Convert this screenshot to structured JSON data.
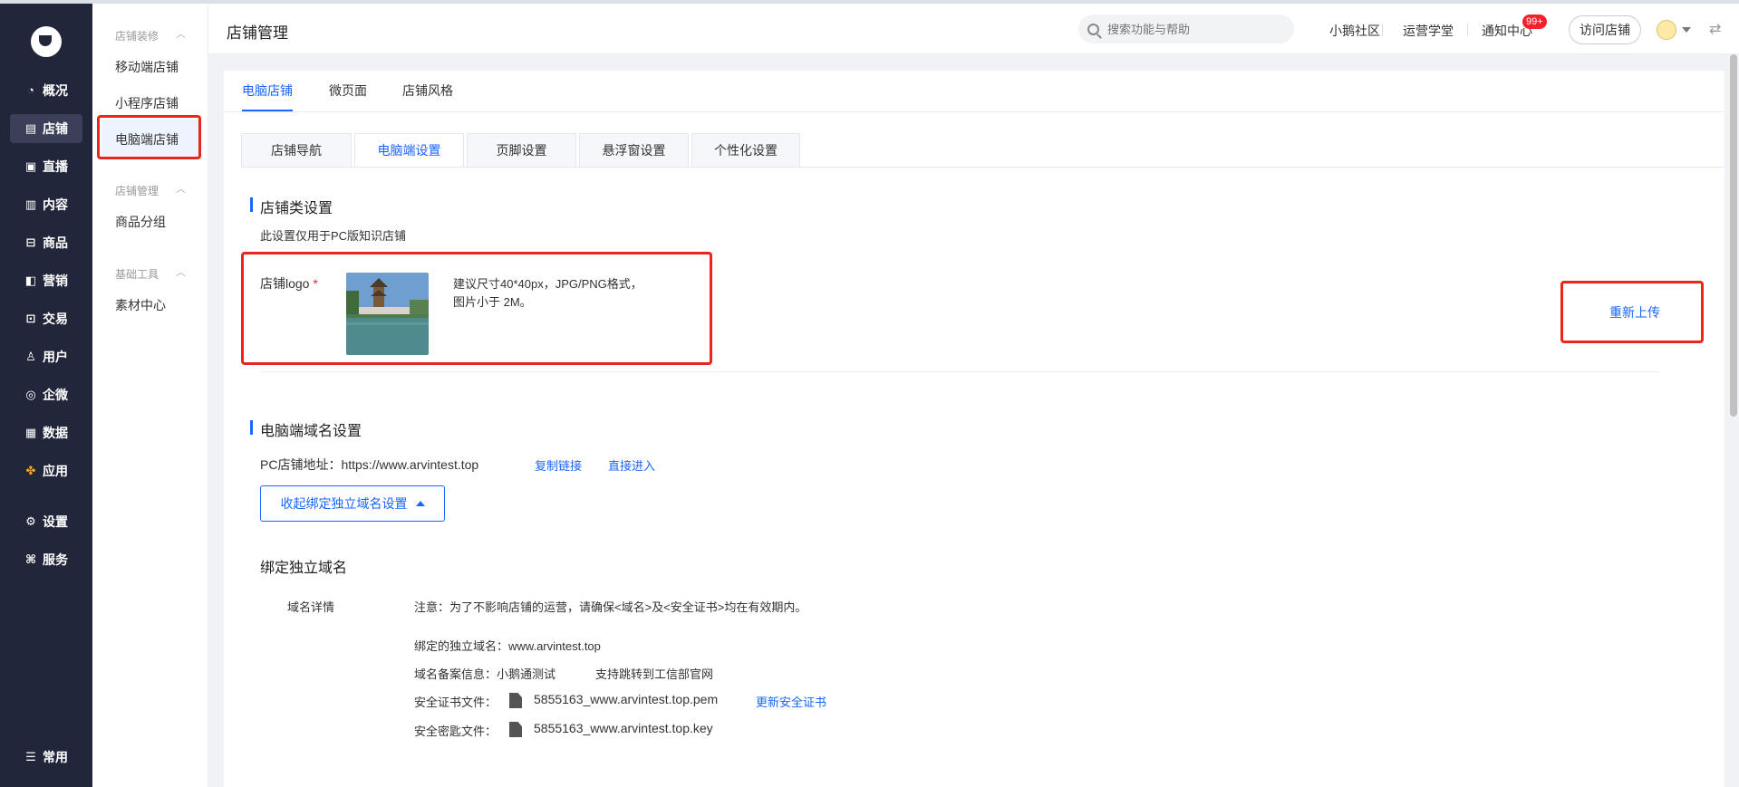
{
  "left_nav": {
    "items": [
      {
        "label": "概况",
        "icon": "pie-chart-icon"
      },
      {
        "label": "店铺",
        "icon": "store-icon"
      },
      {
        "label": "直播",
        "icon": "live-icon"
      },
      {
        "label": "内容",
        "icon": "document-icon"
      },
      {
        "label": "商品",
        "icon": "goods-icon"
      },
      {
        "label": "营销",
        "icon": "megaphone-icon"
      },
      {
        "label": "交易",
        "icon": "trade-icon"
      },
      {
        "label": "用户",
        "icon": "user-icon"
      },
      {
        "label": "企微",
        "icon": "wecom-icon"
      },
      {
        "label": "数据",
        "icon": "data-icon"
      },
      {
        "label": "应用",
        "icon": "apps-icon"
      },
      {
        "label": "设置",
        "icon": "gear-icon"
      },
      {
        "label": "服务",
        "icon": "service-icon"
      }
    ],
    "bottom": {
      "label": "常用",
      "icon": "list-icon"
    },
    "active_index": 1
  },
  "sub_nav": {
    "group1": {
      "title": "店铺装修",
      "items": [
        "移动端店铺",
        "小程序店铺",
        "电脑端店铺"
      ]
    },
    "group2": {
      "title": "店铺管理",
      "items": [
        "商品分组"
      ]
    },
    "group3": {
      "title": "基础工具",
      "items": [
        "素材中心"
      ]
    }
  },
  "header": {
    "title": "店铺管理",
    "search_placeholder": "搜索功能与帮助",
    "links": [
      "小鹅社区",
      "运营学堂",
      "通知中心"
    ],
    "badge": "99+",
    "visit_button": "访问店铺"
  },
  "top_tabs": [
    "电脑店铺",
    "微页面",
    "店铺风格"
  ],
  "card_tabs": [
    "店铺导航",
    "电脑端设置",
    "页脚设置",
    "悬浮窗设置",
    "个性化设置"
  ],
  "store_section": {
    "title": "店铺类设置",
    "desc": "此设置仅用于PC版知识店铺",
    "logo_label": "店铺logo",
    "required_mark": "*",
    "hint_line1": "建议尺寸40*40px，JPG/PNG格式，",
    "hint_line2": "图片小于 2M。",
    "reupload": "重新上传"
  },
  "domain_section": {
    "title": "电脑端域名设置",
    "address_label": "PC店铺地址：",
    "address_value": "https://www.arvintest.top",
    "copy_link": "复制链接",
    "direct_enter": "直接进入",
    "collapse_button": "收起绑定独立域名设置",
    "bind_title": "绑定独立域名",
    "detail_label": "域名详情",
    "notice": "注意：为了不影响店铺的运营，请确保<域名>及<安全证书>均在有效期内。",
    "bound_label": "绑定的独立域名：",
    "bound_value": "www.arvintest.top",
    "icp_label": "域名备案信息：",
    "icp_value": "小鹅通测试",
    "icp_link": "支持跳转到工信部官网",
    "cert_label": "安全证书文件：",
    "cert_file": "5855163_www.arvintest.top.pem",
    "cert_update": "更新安全证书",
    "key_label": "安全密匙文件：",
    "key_file": "5855163_www.arvintest.top.key"
  },
  "colors": {
    "accent": "#1a66ff",
    "sidebar": "#22263a",
    "highlight_box": "#e8261c"
  }
}
